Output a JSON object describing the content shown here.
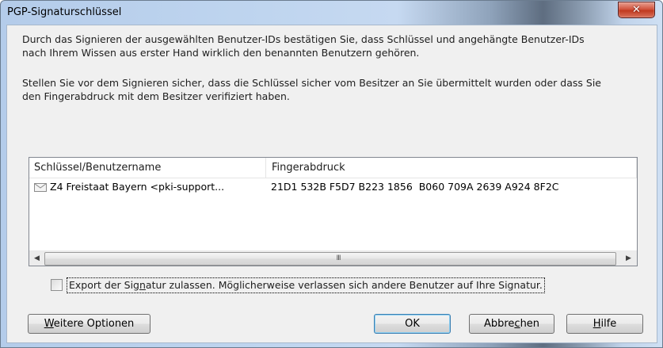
{
  "window": {
    "title": "PGP-Signaturschlüssel",
    "close_glyph": "✕"
  },
  "description": {
    "paragraph1_line1": "Durch das Signieren der ausgewählten Benutzer-IDs bestätigen Sie, dass Schlüssel und angehängte Benutzer-IDs",
    "paragraph1_line2": "nach Ihrem Wissen aus erster Hand wirklich den benannten Benutzern gehören.",
    "paragraph2_line1": "Stellen Sie vor dem Signieren sicher, dass die Schlüssel sicher vom Besitzer an Sie übermittelt wurden oder dass Sie",
    "paragraph2_line2": "den Fingerabdruck mit dem Besitzer verifiziert haben."
  },
  "keylist": {
    "columns": [
      "Schlüssel/Benutzername",
      "Fingerabdruck"
    ],
    "rows": [
      {
        "icon": "envelope-icon",
        "name": "Z4 Freistaat Bayern <pki-support...",
        "fingerprint": "21D1 532B F5D7 B223 1856  B060 709A 2639 A924 8F2C"
      }
    ],
    "scroll_left_glyph": "◀",
    "scroll_right_glyph": "▶",
    "scroll_grip_glyph": "III"
  },
  "export_option": {
    "checked": false,
    "label_pre": "Export der Sig",
    "label_mnemonic": "n",
    "label_post": "atur zulassen. Möglicherweise verlassen sich andere Benutzer auf Ihre Signatur."
  },
  "buttons": {
    "more_options_mnemonic": "W",
    "more_options_rest": "eitere Optionen",
    "ok": "OK",
    "cancel_pre": "Abbre",
    "cancel_mnemonic": "c",
    "cancel_post": "hen",
    "help_mnemonic": "H",
    "help_rest": "ilfe"
  },
  "colors": {
    "close_button": "#c7432a",
    "default_button_border": "#3c7fb1",
    "dialog_background": "#f0f0f0"
  }
}
